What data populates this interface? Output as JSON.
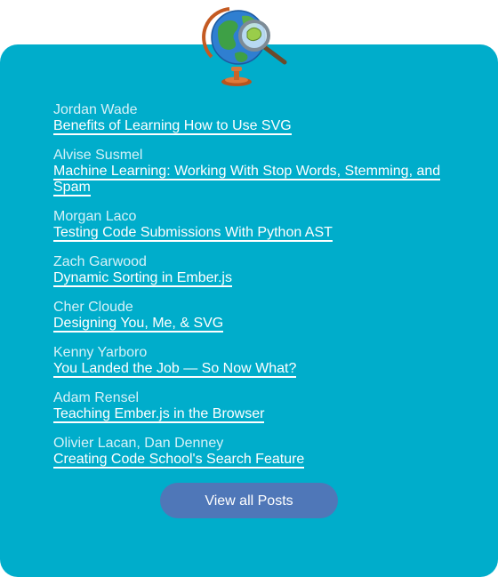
{
  "posts": [
    {
      "author": "Jordan Wade",
      "title": "Benefits of Learning How to Use SVG"
    },
    {
      "author": "Alvise Susmel",
      "title": "Machine Learning: Working With Stop Words, Stemming, and Spam"
    },
    {
      "author": "Morgan Laco",
      "title": "Testing Code Submissions With Python AST"
    },
    {
      "author": "Zach Garwood",
      "title": "Dynamic Sorting in Ember.js"
    },
    {
      "author": "Cher Cloude",
      "title": "Designing You, Me, & SVG"
    },
    {
      "author": "Kenny Yarboro",
      "title": "You Landed the Job — So Now What?"
    },
    {
      "author": "Adam Rensel",
      "title": "Teaching Ember.js in the Browser"
    },
    {
      "author": "Olivier Lacan, Dan Denney",
      "title": "Creating Code School's Search Feature"
    }
  ],
  "view_all_label": "View all Posts",
  "icons": {
    "header": "globe-with-magnifier-icon"
  },
  "colors": {
    "card_background": "#00adcb",
    "button_background": "#4f77b8",
    "link": "#ffffff"
  }
}
